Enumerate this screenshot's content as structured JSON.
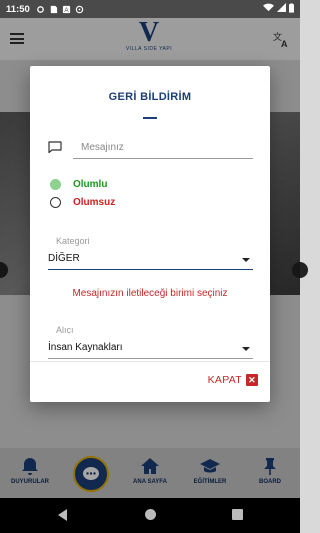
{
  "status_bar": {
    "time": "11:50"
  },
  "header": {
    "logo_main": "V",
    "logo_text": "VILLA SIDE YAPI"
  },
  "dialog": {
    "title": "GERİ BİLDİRİM",
    "message": {
      "placeholder": "Mesajınız"
    },
    "radios": [
      {
        "label": "Olumlu",
        "checked": true
      },
      {
        "label": "Olumsuz",
        "checked": false
      }
    ],
    "category": {
      "label": "Kategori",
      "value": "DİĞER"
    },
    "hint": "Mesajınızın iletileceği birimi seçiniz",
    "recipient": {
      "label": "Alıcı",
      "value": "İnsan Kaynakları"
    },
    "close_label": "KAPAT"
  },
  "bottom_nav": {
    "items": [
      {
        "label": "DUYURULAR",
        "icon": "bell-icon"
      },
      {
        "label": "",
        "icon": "chat-icon"
      },
      {
        "label": "ANA SAYFA",
        "icon": "home-icon"
      },
      {
        "label": "EĞİTİMLER",
        "icon": "graduation-cap-icon"
      },
      {
        "label": "BOARD",
        "icon": "pin-icon"
      }
    ]
  },
  "colors": {
    "primary": "#1c3f7a",
    "positive": "#1c9a1c",
    "negative": "#d32020",
    "accent_ring": "#e3b100"
  }
}
